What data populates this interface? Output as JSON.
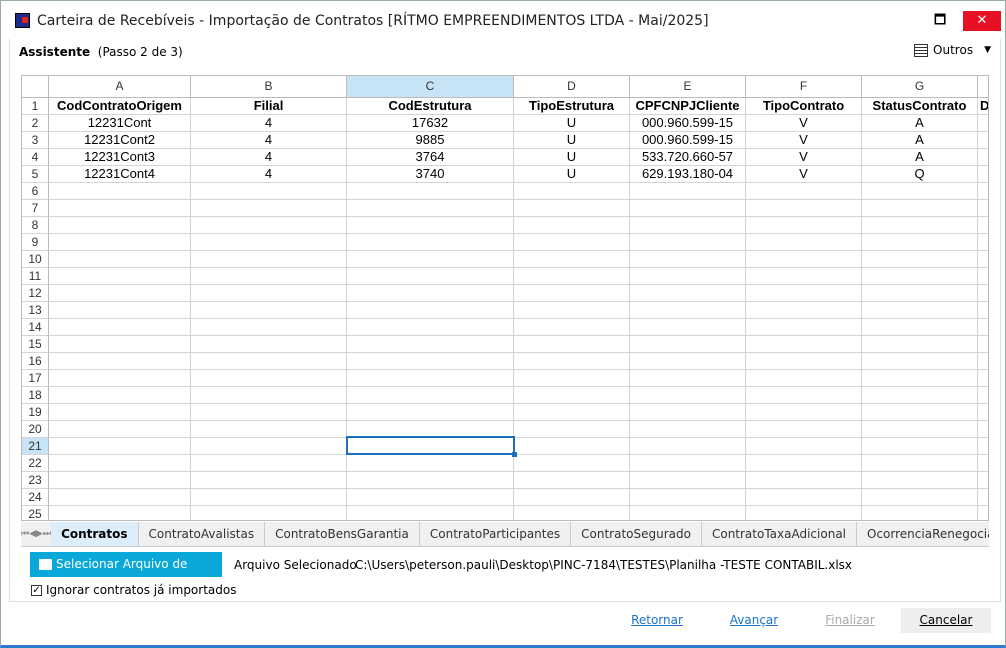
{
  "window": {
    "title": "Carteira de Recebíveis - Importação de Contratos [RÍTMO EMPREENDIMENTOS LTDA - Mai/2025]",
    "minimize": "🗖",
    "close": "✕"
  },
  "header": {
    "assistente": "Assistente",
    "passo": "(Passo 2 de 3)",
    "outros": "Outros"
  },
  "grid": {
    "columns": [
      "A",
      "B",
      "C",
      "D",
      "E",
      "F",
      "G"
    ],
    "selected_column": "C",
    "selected_row": 21,
    "headers": [
      "CodContratoOrigem",
      "Filial",
      "CodEstrutura",
      "TipoEstrutura",
      "CPFCNPJCliente",
      "TipoContrato",
      "StatusContrato",
      "D"
    ],
    "rows": [
      [
        "12231Cont",
        "4",
        "17632",
        "U",
        "000.960.599-15",
        "V",
        "A"
      ],
      [
        "12231Cont2",
        "4",
        "9885",
        "U",
        "000.960.599-15",
        "V",
        "A"
      ],
      [
        "12231Cont3",
        "4",
        "3764",
        "U",
        "533.720.660-57",
        "V",
        "A"
      ],
      [
        "12231Cont4",
        "4",
        "3740",
        "U",
        "629.193.180-04",
        "V",
        "Q"
      ]
    ],
    "row_count": 25
  },
  "sheets": {
    "active": "Contratos",
    "tabs": [
      "Contratos",
      "ContratoAvalistas",
      "ContratoBensGarantia",
      "ContratoParticipantes",
      "ContratoSegurado",
      "ContratoTaxaAdicional",
      "OcorrenciaRenegociacao"
    ]
  },
  "file": {
    "button": "Selecionar Arquivo de Dados",
    "label": "Arquivo Selecionado",
    "path": "C:\\Users\\peterson.pauli\\Desktop\\PINC-7184\\TESTES\\Planilha -TESTE CONTABIL.xlsx"
  },
  "ignore": {
    "label": "Ignorar contratos já importados",
    "checked": true
  },
  "footer": {
    "retornar": "Retornar",
    "avancar": "Avançar",
    "finalizar": "Finalizar",
    "cancelar": "Cancelar"
  },
  "colors": {
    "accent": "#0aa8d8",
    "selection": "#1f6fc0",
    "link": "#1a73c8"
  }
}
